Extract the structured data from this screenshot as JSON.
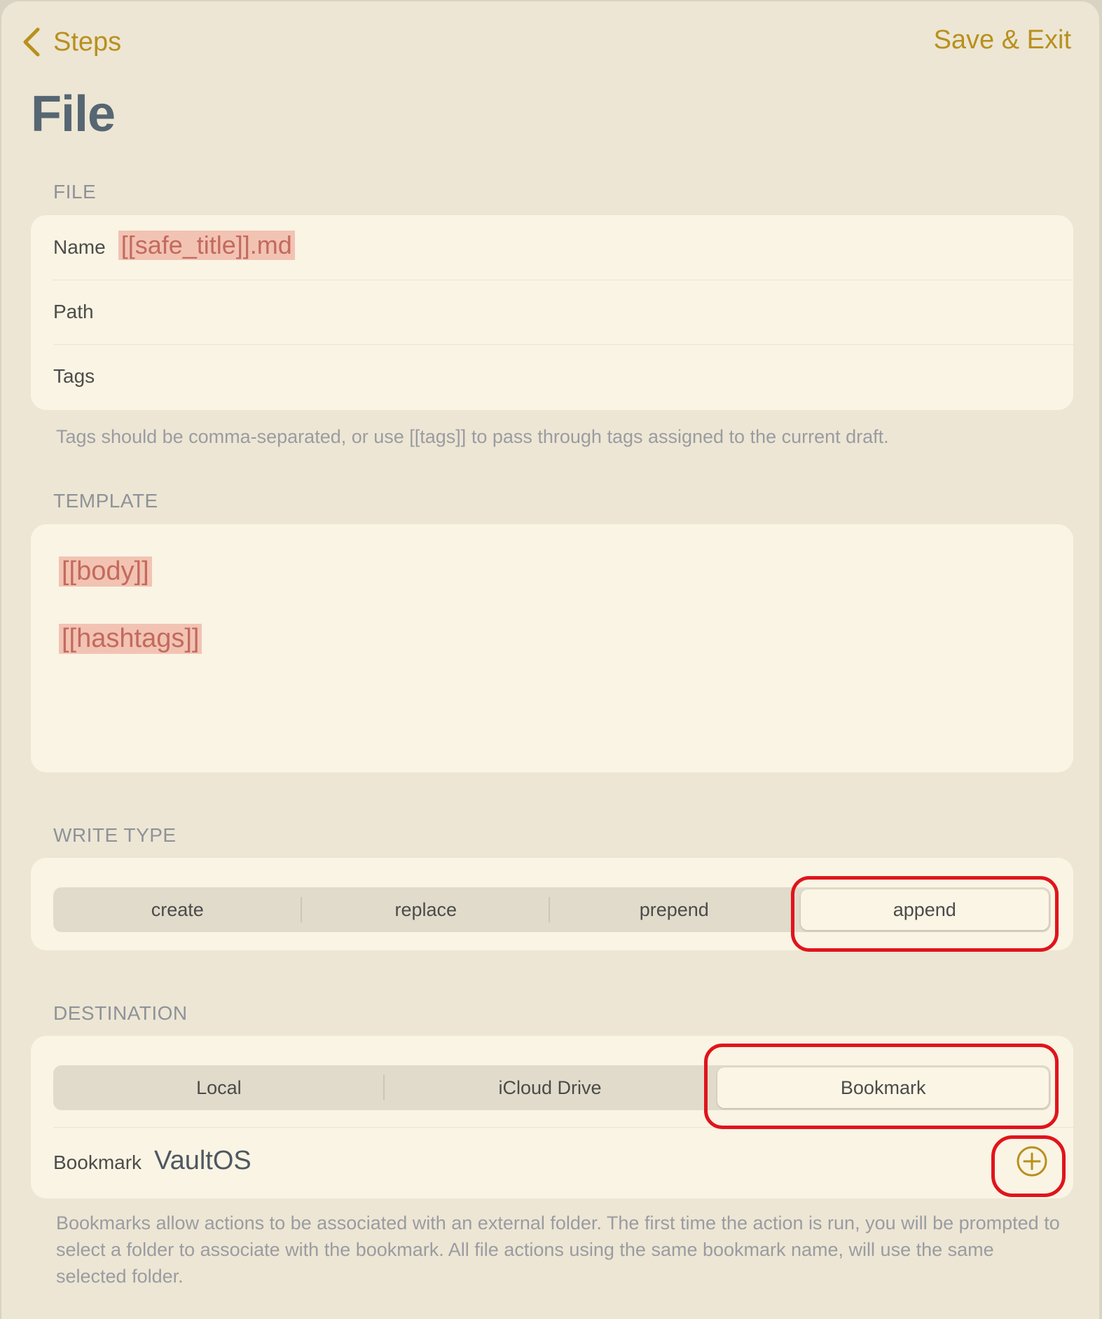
{
  "nav": {
    "back_label": "Steps",
    "save_label": "Save & Exit"
  },
  "page": {
    "title": "File"
  },
  "file_section": {
    "header": "FILE",
    "name_label": "Name",
    "name_value": "[[safe_title]].md",
    "path_label": "Path",
    "path_value": "",
    "tags_label": "Tags",
    "tags_value": "",
    "footnote": "Tags should be comma-separated, or use [[tags]] to pass through tags assigned to the current draft."
  },
  "template_section": {
    "header": "TEMPLATE",
    "lines": [
      "[[body]]",
      "[[hashtags]]"
    ]
  },
  "write_type": {
    "header": "WRITE TYPE",
    "options": [
      "create",
      "replace",
      "prepend",
      "append"
    ],
    "selected": "append"
  },
  "destination": {
    "header": "DESTINATION",
    "options": [
      "Local",
      "iCloud Drive",
      "Bookmark"
    ],
    "selected": "Bookmark",
    "bookmark_label": "Bookmark",
    "bookmark_value": "VaultOS",
    "footnote": "Bookmarks allow actions to be associated with an external folder. The first time the action is run, you will be prompted to select a folder to associate with the bookmark. All file actions using the same bookmark name, will use the same selected folder."
  },
  "colors": {
    "accent": "#b8901e",
    "annotation": "#e0141c",
    "token_bg": "#f2c3b3",
    "token_text": "#c36a5e"
  },
  "icons": {
    "back": "chevron-left-icon",
    "add": "plus-circle-icon"
  }
}
